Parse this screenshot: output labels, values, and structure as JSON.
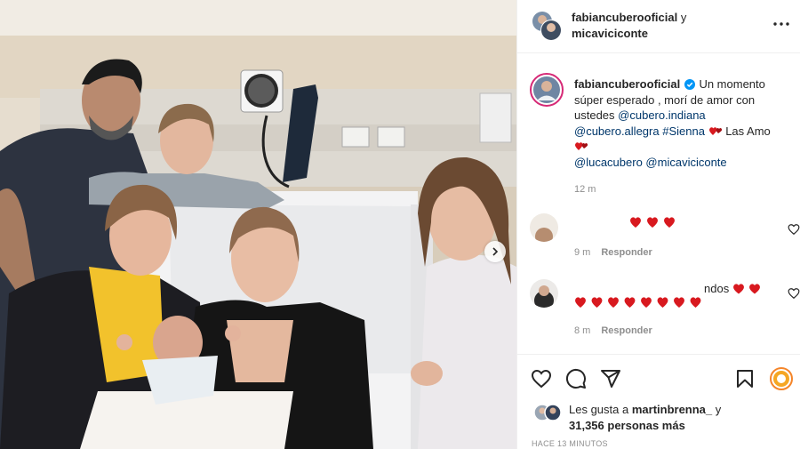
{
  "post": {
    "photo_alt": "",
    "author": "fabiancuberooficial",
    "coauthor_joiner": "y",
    "coauthor": "micaviciconte"
  },
  "caption": {
    "username": "fabiancuberooficial",
    "text_1": "Un momento súper esperado , morí de amor con ustedes",
    "mention_1": "@cubero.indiana",
    "mention_2": "@cubero.allegra",
    "hashtag": "#Sienna",
    "text_2": "Las Amo",
    "mention_3": "@lucacubero",
    "mention_4": "@micaviciconte",
    "time": "12 m"
  },
  "comments": [
    {
      "text": "",
      "meta_time": "9 m",
      "reply_label": "Responder",
      "hearts": 3
    },
    {
      "text_tail": "ndos",
      "meta_time": "8 m",
      "reply_label": "Responder",
      "hearts": 10
    }
  ],
  "likes": {
    "prefix": "Les gusta a",
    "user": "martinbrenna_",
    "joiner": "y",
    "count_text": "31,356 personas más"
  },
  "posted_ago": "HACE 13 MINUTOS",
  "icons": {
    "like": "heart-outline-icon",
    "comment": "comment-bubble-icon",
    "share": "paper-plane-icon",
    "save": "bookmark-icon",
    "more": "ellipsis-icon",
    "next": "chevron-right-icon",
    "verified": "verified-badge-icon"
  },
  "colors": {
    "mention": "#00376b",
    "verified": "#0095f6",
    "heart_emoji": "#d8191f",
    "muted": "#8e8e8e"
  }
}
